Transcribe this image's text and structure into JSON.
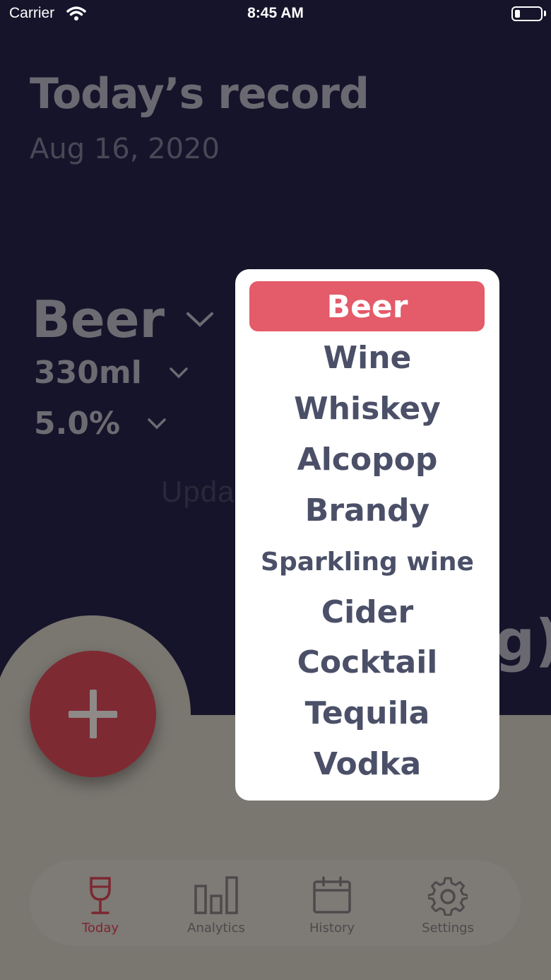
{
  "status_bar": {
    "carrier": "Carrier",
    "time": "8:45 AM"
  },
  "header": {
    "title": "Today’s record",
    "date": "Aug 16, 2020"
  },
  "drink": {
    "type": "Beer",
    "volume": "330ml",
    "abv": "5.0%"
  },
  "background_fragment": "g)",
  "dropdown": {
    "selected": "Beer",
    "options": [
      "Beer",
      "Wine",
      "Whiskey",
      "Alcopop",
      "Brandy",
      "Sparkling wine",
      "Cider",
      "Cocktail",
      "Tequila",
      "Vodka"
    ]
  },
  "tabs": [
    {
      "label": "Today",
      "icon": "wine-glass-icon",
      "active": true
    },
    {
      "label": "Analytics",
      "icon": "bar-chart-icon",
      "active": false
    },
    {
      "label": "History",
      "icon": "calendar-icon",
      "active": false
    },
    {
      "label": "Settings",
      "icon": "gear-icon",
      "active": false
    }
  ],
  "watermark": "UpdateStar.com",
  "colors": {
    "background": "#16142a",
    "accent": "#e45b6a",
    "menu_text": "#4b5068"
  }
}
